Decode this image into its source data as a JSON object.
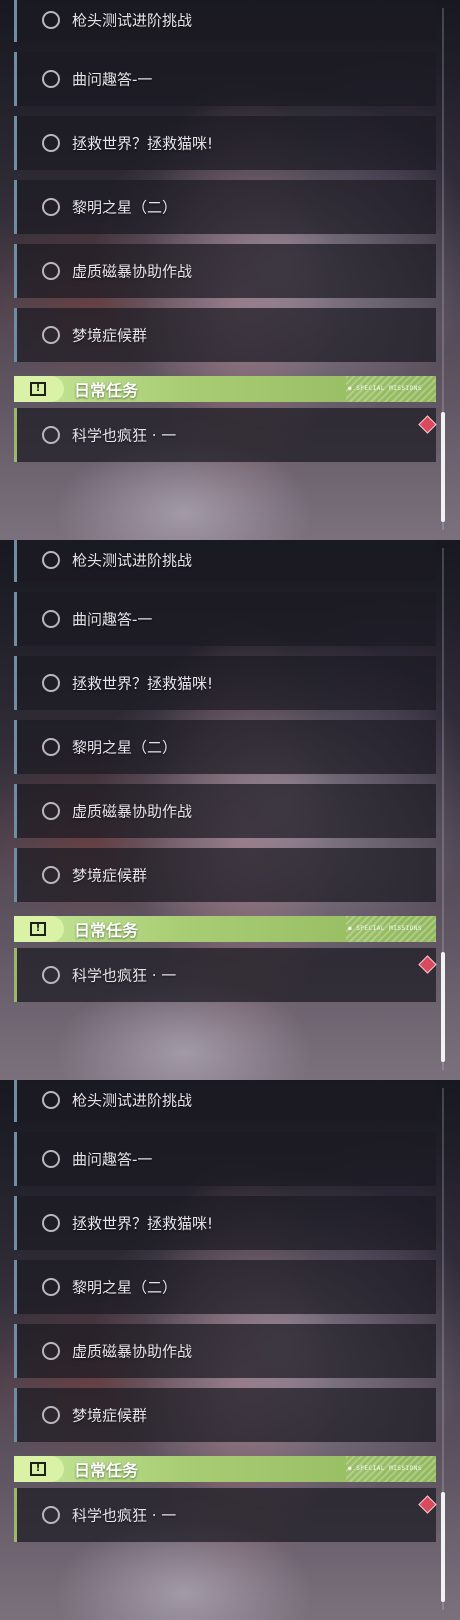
{
  "task_list": {
    "tasks": [
      "枪头测试进阶挑战",
      "曲问趣答-一",
      "拯救世界？拯救猫咪!",
      "黎明之星（二）",
      "虚质磁暴协助作战",
      "梦境症候群"
    ]
  },
  "daily_section": {
    "title": "日常任务",
    "decoration": "● SPECIAL MISSIONS",
    "icon": "alert-icon",
    "tasks": [
      "科学也疯狂 · 一"
    ]
  },
  "colors": {
    "section_accent": "#a8cd74",
    "notification": "#d84a5e",
    "story_border": "#6f8ea6"
  }
}
